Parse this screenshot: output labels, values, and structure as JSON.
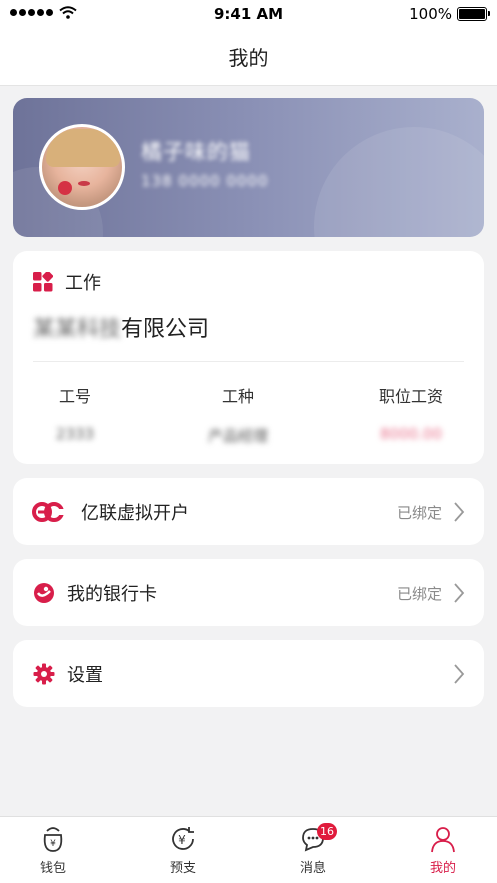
{
  "status_bar": {
    "time": "9:41 AM",
    "battery": "100%"
  },
  "nav": {
    "title": "我的"
  },
  "profile": {
    "name": "橘子味的猫",
    "phone": "138 0000 0000"
  },
  "work": {
    "section_label": "工作",
    "company_blurred": "某某科技",
    "company_suffix": "有限公司",
    "stats": [
      {
        "label": "工号",
        "value": "2333"
      },
      {
        "label": "工种",
        "value": "产品经理"
      },
      {
        "label": "职位工资",
        "value": "8000.00"
      }
    ]
  },
  "menu": [
    {
      "label": "亿联虚拟开户",
      "status": "已绑定",
      "icon": "eo-logo-icon"
    },
    {
      "label": "我的银行卡",
      "status": "已绑定",
      "icon": "bank-card-icon"
    },
    {
      "label": "设置",
      "status": "",
      "icon": "gear-icon"
    }
  ],
  "tabs": [
    {
      "label": "钱包",
      "icon": "wallet-icon"
    },
    {
      "label": "预支",
      "icon": "yen-refresh-icon"
    },
    {
      "label": "消息",
      "icon": "chat-icon",
      "badge": "16"
    },
    {
      "label": "我的",
      "icon": "person-icon"
    }
  ],
  "colors": {
    "accent": "#d81e4a",
    "card_gradient_start": "#6e7399",
    "card_gradient_end": "#a9b0cd"
  }
}
